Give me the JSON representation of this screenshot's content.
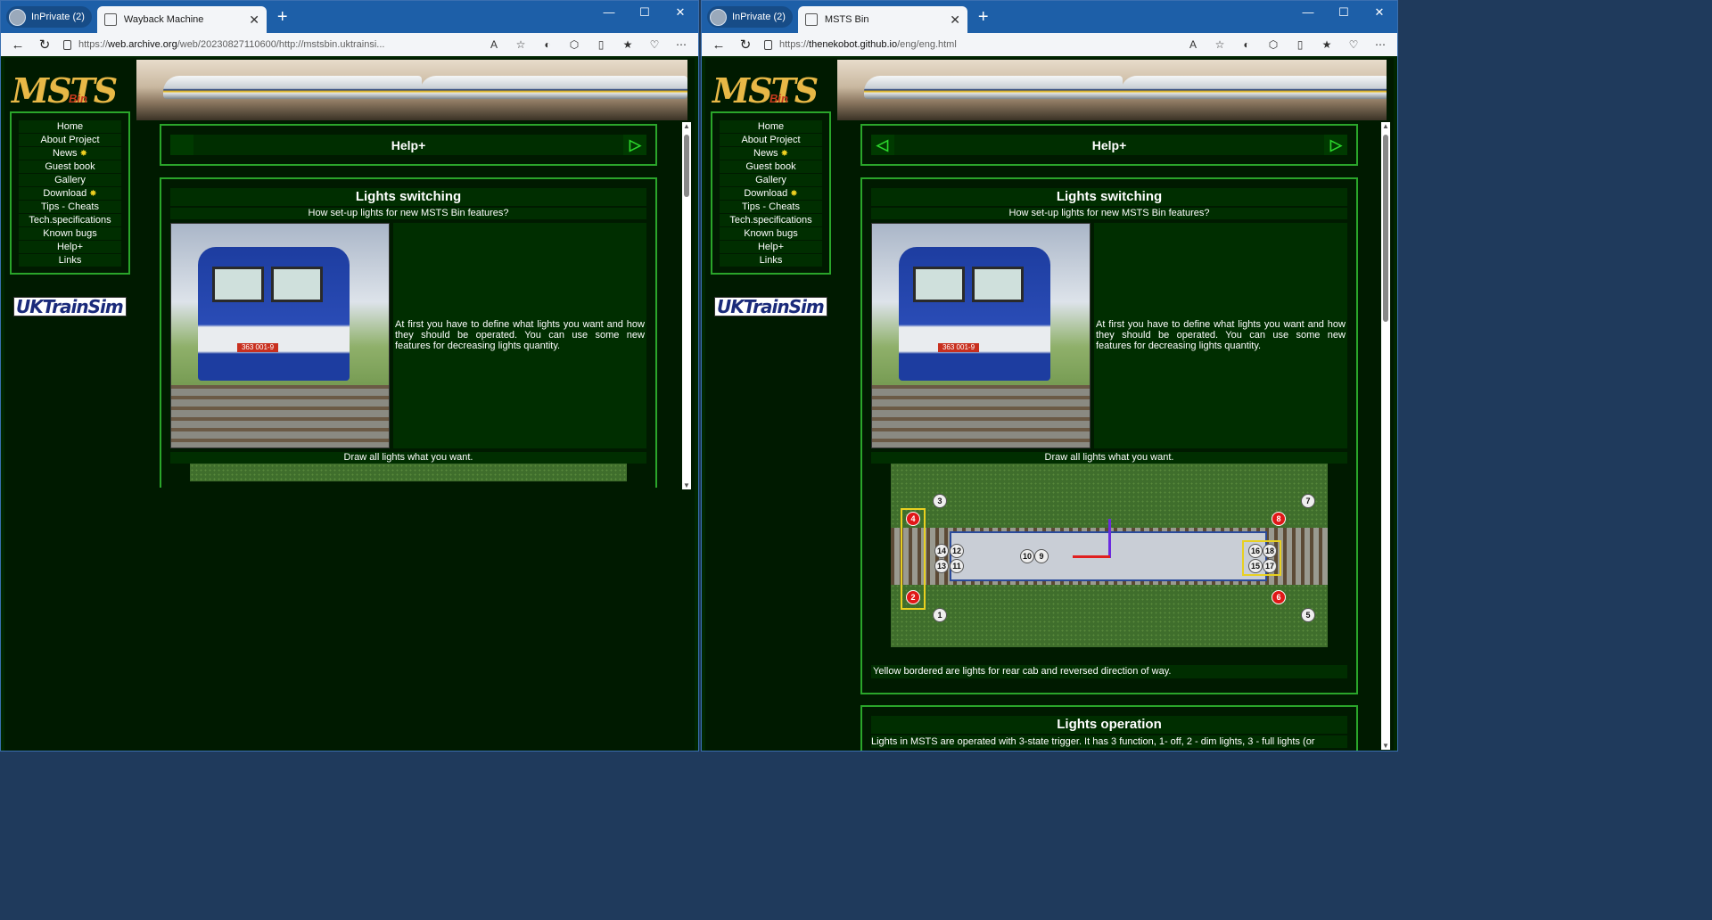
{
  "windows": [
    {
      "inprivate": "InPrivate (2)",
      "tab_title": "Wayback Machine",
      "url_prefix": "https://",
      "url_host": "web.archive.org",
      "url_rest": "/web/20230827110600/http://mstsbin.uktrainsi...",
      "menu": [
        "Home",
        "About Project",
        "News",
        "Guest book",
        "Gallery",
        "Download",
        "Tips - Cheats",
        "Tech.specifications",
        "Known bugs",
        "Help+",
        "Links"
      ],
      "help_title": "Help+",
      "section_title": "Lights switching",
      "section_sub": "How set-up lights for new MSTS Bin features?",
      "section_text": "At first you have to define what lights you want and how they should be operated. You can use some new features for decreasing lights quantity.",
      "caption": "Draw all lights what you want."
    },
    {
      "inprivate": "InPrivate (2)",
      "tab_title": "MSTS Bin",
      "url_prefix": "https://",
      "url_host": "thenekobot.github.io",
      "url_rest": "/eng/eng.html",
      "menu": [
        "Home",
        "About Project",
        "News",
        "Guest book",
        "Gallery",
        "Download",
        "Tips - Cheats",
        "Tech.specifications",
        "Known bugs",
        "Help+",
        "Links"
      ],
      "help_title": "Help+",
      "section_title": "Lights switching",
      "section_sub": "How set-up lights for new MSTS Bin features?",
      "section_text": "At first you have to define what lights you want and how they should be operated. You can use some new features for decreasing lights quantity.",
      "caption": "Draw all lights what you want.",
      "footnote": "Yellow bordered are lights for rear cab and reversed direction of way.",
      "section2_title": "Lights operation",
      "section2_text": "Lights in MSTS are operated with 3-state trigger. It has 3 function, 1- off, 2 - dim lights, 3 - full lights (or"
    }
  ],
  "logo": {
    "main": "MSTS",
    "sub": "Bin"
  },
  "uktrainsim": "UKTrainSim",
  "plate": "363 001-9",
  "lights": {
    "white": [
      "3",
      "7",
      "1",
      "5",
      "14",
      "12",
      "13",
      "11",
      "10",
      "9",
      "16",
      "18",
      "15",
      "17"
    ],
    "red": [
      "4",
      "2",
      "8",
      "6"
    ]
  },
  "window_controls": [
    "—",
    "☐",
    "✕"
  ],
  "colors": {
    "accent_green": "#2aa52a",
    "page_bg": "#001a00",
    "panel_bg": "#002e00",
    "arrow_green": "#2cd62c"
  }
}
